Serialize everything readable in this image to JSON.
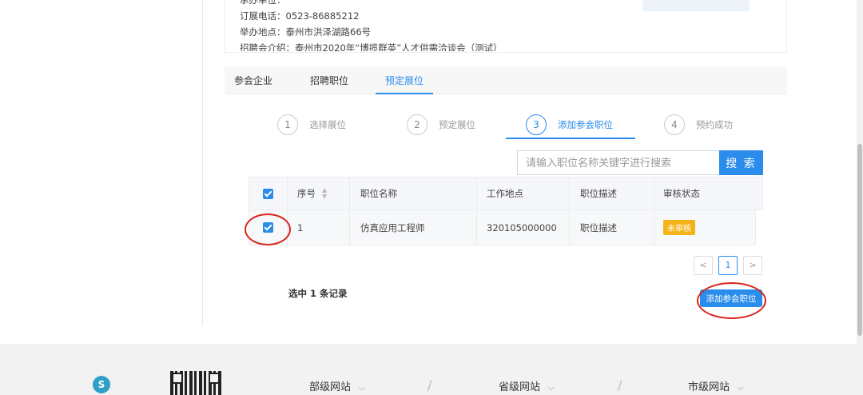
{
  "info": {
    "organizer_partial": "承办单位：",
    "phone": "订展电话：0523-86885212",
    "address": "举办地点：泰州市洪泽湖路66号",
    "intro": "招聘会介绍：泰州市2020年“博揽群英”人才供需洽谈会（测试）"
  },
  "tabs": [
    {
      "label": "参会企业",
      "active": false
    },
    {
      "label": "招聘职位",
      "active": false
    },
    {
      "label": "预定展位",
      "active": true
    }
  ],
  "steps": [
    {
      "num": "1",
      "label": "选择展位",
      "active": false
    },
    {
      "num": "2",
      "label": "预定展位",
      "active": false
    },
    {
      "num": "3",
      "label": "添加参会职位",
      "active": true
    },
    {
      "num": "4",
      "label": "预约成功",
      "active": false
    }
  ],
  "search": {
    "placeholder": "请输入职位名称关键字进行搜索",
    "button_label": "搜 索"
  },
  "table": {
    "headers": [
      "序号",
      "职位名称",
      "工作地点",
      "职位描述",
      "审核状态"
    ],
    "rows": [
      {
        "index": "1",
        "name": "仿真应用工程师",
        "location": "320105000000",
        "desc": "职位描述",
        "status": "未审核",
        "checked": true
      }
    ],
    "all_checked": true
  },
  "pagination": {
    "prev": "<",
    "current": "1",
    "next": ">"
  },
  "selected_text": "选中 1 条记录",
  "add_button_label": "添加参会职位",
  "footer": {
    "logo_glyph": "S",
    "links": [
      {
        "label": "部级网站"
      },
      {
        "label": "省级网站"
      },
      {
        "label": "市级网站"
      }
    ],
    "chevron": "⌵",
    "separator": "/"
  },
  "colors": {
    "accent": "#2a8ceb",
    "pending_badge": "#f5b31a",
    "annotation": "#d9251c"
  }
}
